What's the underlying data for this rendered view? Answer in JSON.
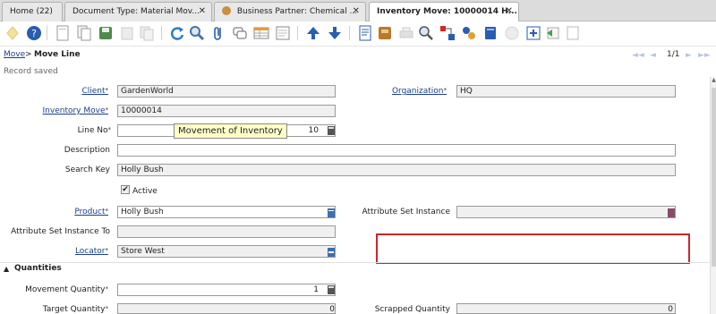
{
  "tabs": [
    {
      "label": "Home (22)",
      "active": false
    },
    {
      "label": "Document Type: Material Mov...",
      "active": false
    },
    {
      "label": "Business Partner: Chemical ...",
      "active": false
    },
    {
      "label": "Inventory Move: 10000014 H...",
      "active": true
    }
  ],
  "tab_close_glyph": "✕",
  "toolbar_icons": [
    "ignore-icon",
    "help-icon",
    "new-record-icon",
    "copy-record-icon",
    "save-icon",
    "delete-icon",
    "delete-selection-icon",
    "refresh-icon",
    "find-icon",
    "attachment-icon",
    "chat-icon",
    "grid-toggle-icon",
    "previous-record-icon",
    "next-record-icon",
    "report-icon",
    "archive-icon",
    "print-icon",
    "zoom-across-icon",
    "workflow-icon",
    "active-workflows-icon",
    "requests-icon",
    "product-info-icon",
    "process-icon",
    "export-icon",
    "post-icon"
  ],
  "breadcrumb": {
    "parent": "Move",
    "separator": ">",
    "current": "Move Line"
  },
  "pager": "1/1",
  "status": "Record saved",
  "form": {
    "client": {
      "label": "Client",
      "value": "GardenWorld"
    },
    "organization": {
      "label": "Organization",
      "value": "HQ"
    },
    "inventory_move": {
      "label": "Inventory Move",
      "value": "10000014"
    },
    "line_no": {
      "label": "Line No",
      "value": "10"
    },
    "tooltip": "Movement of Inventory",
    "description": {
      "label": "Description",
      "value": ""
    },
    "search_key": {
      "label": "Search Key",
      "value": "Holly Bush"
    },
    "active": {
      "label": "Active",
      "checked": true,
      "glyph": "✔"
    },
    "product": {
      "label": "Product",
      "value": "Holly Bush"
    },
    "attribute_set_instance": {
      "label": "Attribute Set Instance",
      "value": ""
    },
    "attribute_set_instance_to": {
      "label": "Attribute Set Instance To",
      "value": ""
    },
    "locator": {
      "label": "Locator",
      "value": "Store West"
    }
  },
  "quantities": {
    "section_title": "Quantities",
    "movement_quantity": {
      "label": "Movement Quantity",
      "value": "1"
    },
    "target_quantity": {
      "label": "Target Quantity",
      "value": "0"
    },
    "scrapped_quantity": {
      "label": "Scrapped Quantity",
      "value": "0"
    }
  },
  "required_mark": "*",
  "colors": {
    "link": "#1a3f8f",
    "highlight_border": "#c8282c",
    "tooltip_bg": "#ffffc8",
    "toolbar_blue": "#2a5db0"
  }
}
